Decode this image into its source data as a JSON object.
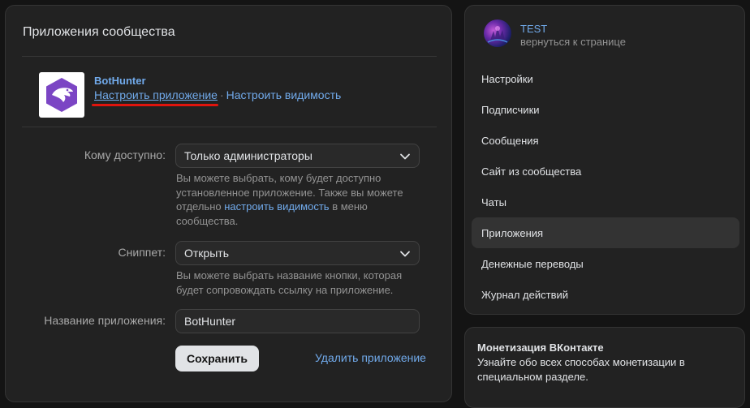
{
  "main": {
    "title": "Приложения сообщества",
    "app": {
      "logo_icon": "eagle-hexagon-logo",
      "name": "BotHunter",
      "configure_link": "Настроить приложение",
      "separator": "·",
      "visibility_link": "Настроить видимость"
    },
    "access": {
      "label": "Кому доступно:",
      "value": "Только администраторы",
      "hint_part1": "Вы можете выбрать, кому будет доступно установленное приложение. Также вы можете отдельно ",
      "hint_link": "настроить видимость",
      "hint_part2": " в меню сообщества."
    },
    "snippet": {
      "label": "Сниппет:",
      "value": "Открыть",
      "hint": "Вы можете выбрать название кнопки, которая будет сопровождать ссылку на приложение."
    },
    "app_name_field": {
      "label": "Название приложения:",
      "value": "BotHunter"
    },
    "save_label": "Сохранить",
    "delete_label": "Удалить приложение"
  },
  "sidebar": {
    "group_name": "TEST",
    "back_label": "вернуться к странице",
    "items": [
      {
        "label": "Настройки",
        "active": false
      },
      {
        "label": "Подписчики",
        "active": false
      },
      {
        "label": "Сообщения",
        "active": false
      },
      {
        "label": "Сайт из сообщества",
        "active": false
      },
      {
        "label": "Чаты",
        "active": false
      },
      {
        "label": "Приложения",
        "active": true
      },
      {
        "label": "Денежные переводы",
        "active": false
      },
      {
        "label": "Журнал действий",
        "active": false
      }
    ]
  },
  "promo": {
    "title": "Монетизация ВКонтакте",
    "text": "Узнайте обо всех способах монетизации в специальном разделе."
  },
  "colors": {
    "accent": "#71aaeb",
    "highlight_underline": "#e0140d",
    "app_logo": "#7b45c4"
  }
}
